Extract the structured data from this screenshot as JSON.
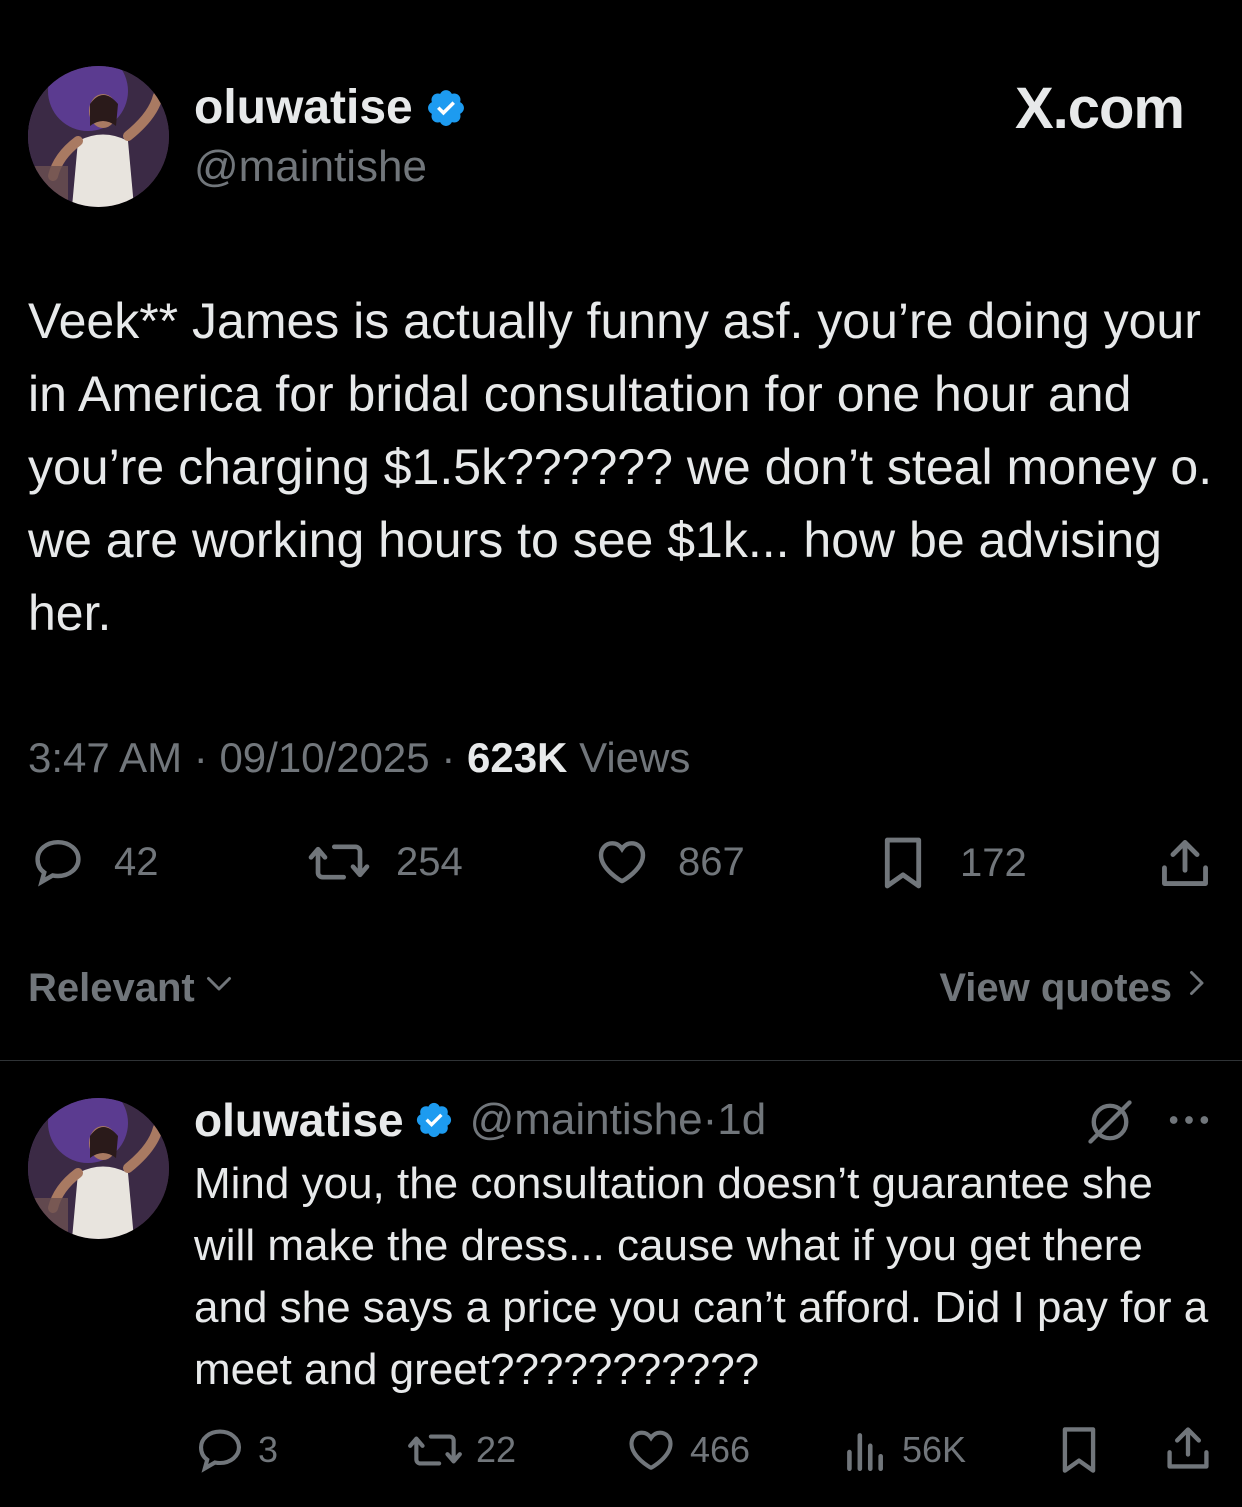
{
  "header": {
    "display_name": "oluwatise",
    "handle": "@maintishe",
    "brand": "X.com",
    "verified_color": "#1d9bf0"
  },
  "tweet": {
    "text": "Veek** James is actually funny asf. you’re doing your in America for bridal consultation for one hour and you’re charging $1.5k?????? we don’t steal money o. we are working hours to see $1k... how be advising her.",
    "time": "3:47 AM",
    "date": "09/10/2025",
    "views_count": "623K",
    "views_label": "Views",
    "stats": {
      "replies": "42",
      "reposts": "254",
      "likes": "867",
      "bookmarks": "172"
    }
  },
  "controls": {
    "sort_label": "Relevant",
    "view_quotes_label": "View quotes"
  },
  "reply": {
    "display_name": "oluwatise",
    "handle": "@maintishe",
    "age": "1d",
    "text": "Mind you, the consultation doesn’t guarantee she will make the dress... cause what if you get there and she says a price you can’t afford. Did I pay for a meet and greet???????????",
    "stats": {
      "replies": "3",
      "reposts": "22",
      "likes": "466",
      "views": "56K"
    }
  },
  "icons": {
    "reply": "speech-bubble-icon",
    "repost": "repost-arrows-icon",
    "like": "heart-icon",
    "bookmark": "bookmark-icon",
    "share": "share-upload-icon",
    "views": "bar-chart-icon",
    "grok": "grok-slash-icon",
    "more": "more-dots-icon",
    "verified": "verified-badge-icon"
  }
}
